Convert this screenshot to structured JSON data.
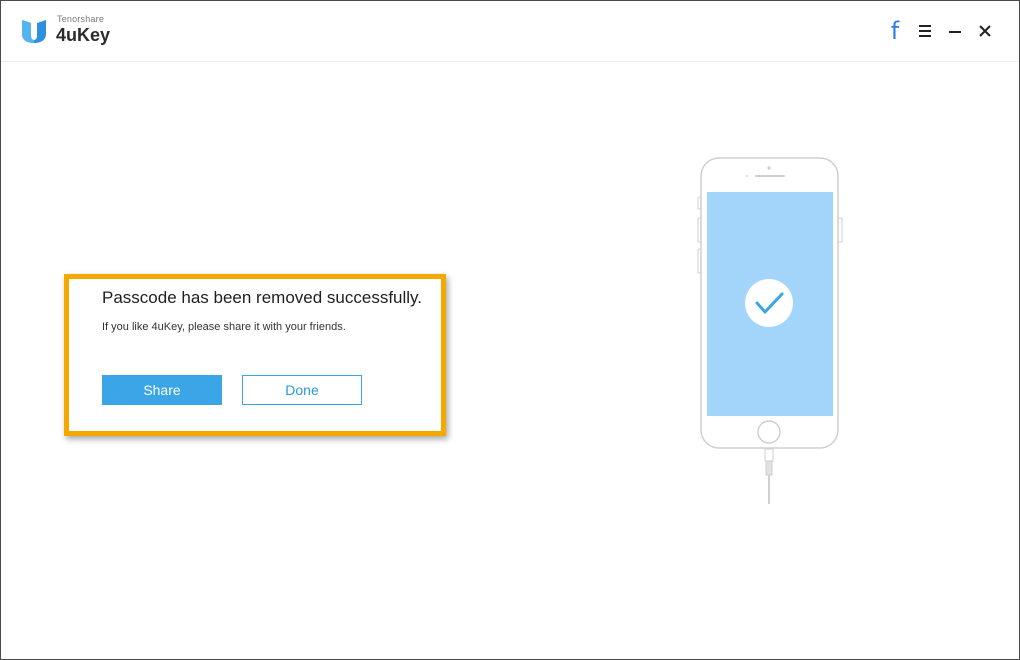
{
  "app": {
    "vendor": "Tenorshare",
    "name": "4uKey",
    "logo_icon": "tenorshare-u-logo"
  },
  "window_controls": {
    "facebook_glyph": "f",
    "facebook_icon": "facebook-icon",
    "menu_icon": "menu-icon",
    "minimize_icon": "minimize-icon",
    "close_icon": "close-icon"
  },
  "dialog": {
    "title": "Passcode has been removed successfully.",
    "subtitle": "If you like 4uKey, please share it with your friends.",
    "share_label": "Share",
    "done_label": "Done"
  },
  "illustration": {
    "device": "iphone-illustration",
    "status_icon": "checkmark-icon"
  },
  "colors": {
    "accent": "#3aa6e8",
    "highlight": "#f5a800",
    "screen": "#a3d5fb",
    "facebook": "#2f7fe0"
  }
}
